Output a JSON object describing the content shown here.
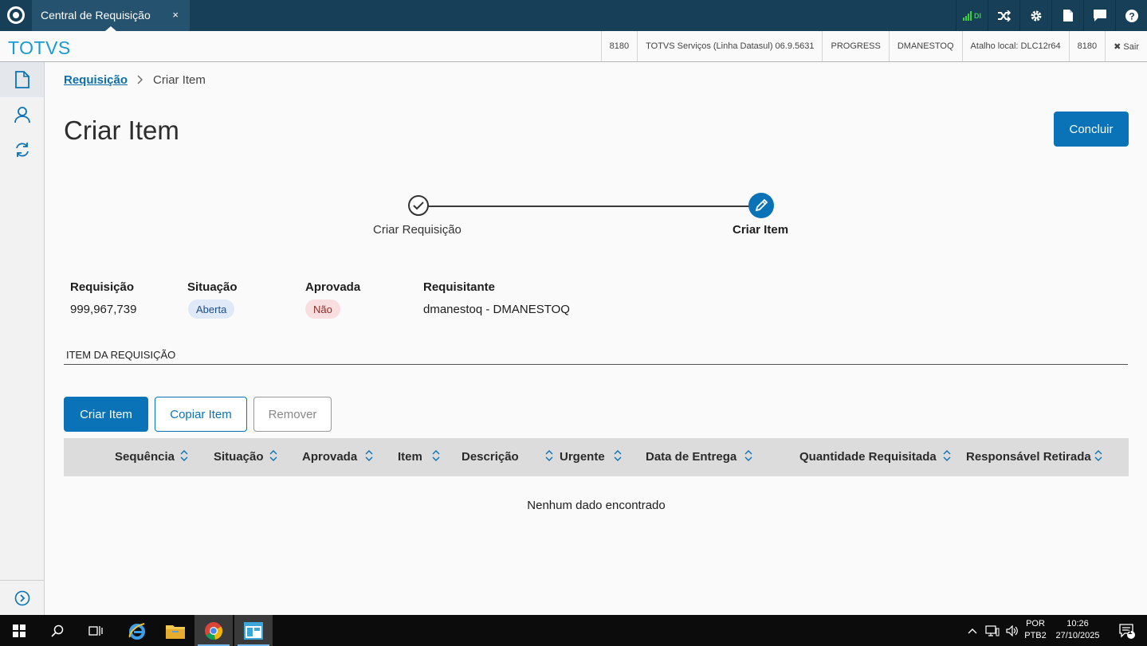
{
  "topbar": {
    "tab_title": "Central de Requisição",
    "tab_close": "×",
    "signal_label": "DI"
  },
  "header": {
    "brand": "TOTVS",
    "info": [
      "8180",
      "TOTVS Serviços (Linha Datasul) 06.9.5631",
      "PROGRESS",
      "DMANESTOQ",
      "Atalho local: DLC12r64",
      "8180"
    ],
    "sair": "✖ Sair"
  },
  "breadcrumb": {
    "parent": "Requisição",
    "separator": ">",
    "current": "Criar Item"
  },
  "page": {
    "title": "Criar Item",
    "primary_action": "Concluir"
  },
  "stepper": {
    "steps": [
      {
        "label": "Criar Requisição",
        "status": "done"
      },
      {
        "label": "Criar Item",
        "status": "active"
      }
    ]
  },
  "details": {
    "requisicao_label": "Requisição",
    "requisicao_value": "999,967,739",
    "situacao_label": "Situação",
    "situacao_value": "Aberta",
    "aprovada_label": "Aprovada",
    "aprovada_value": "Não",
    "requisitante_label": "Requisitante",
    "requisitante_value": "dmanestoq - DMANESTOQ"
  },
  "section": {
    "title": "ITEM DA REQUISIÇÃO"
  },
  "actions": {
    "create": "Criar Item",
    "copy": "Copiar Item",
    "remove": "Remover"
  },
  "table": {
    "columns": [
      "Sequência",
      "Situação",
      "Aprovada",
      "Item",
      "Descrição",
      "Urgente",
      "Data de Entrega",
      "Quantidade Requisitada",
      "Responsável Retirada"
    ],
    "rows": [],
    "empty_message": "Nenhum dado encontrado"
  },
  "taskbar": {
    "lang_top": "POR",
    "lang_bottom": "PTB2",
    "time": "10:26",
    "date": "27/10/2025",
    "notification_count": "1"
  },
  "colors": {
    "topbar": "#173f58",
    "brand": "#1a9bd3",
    "primary": "#0a73b8"
  }
}
